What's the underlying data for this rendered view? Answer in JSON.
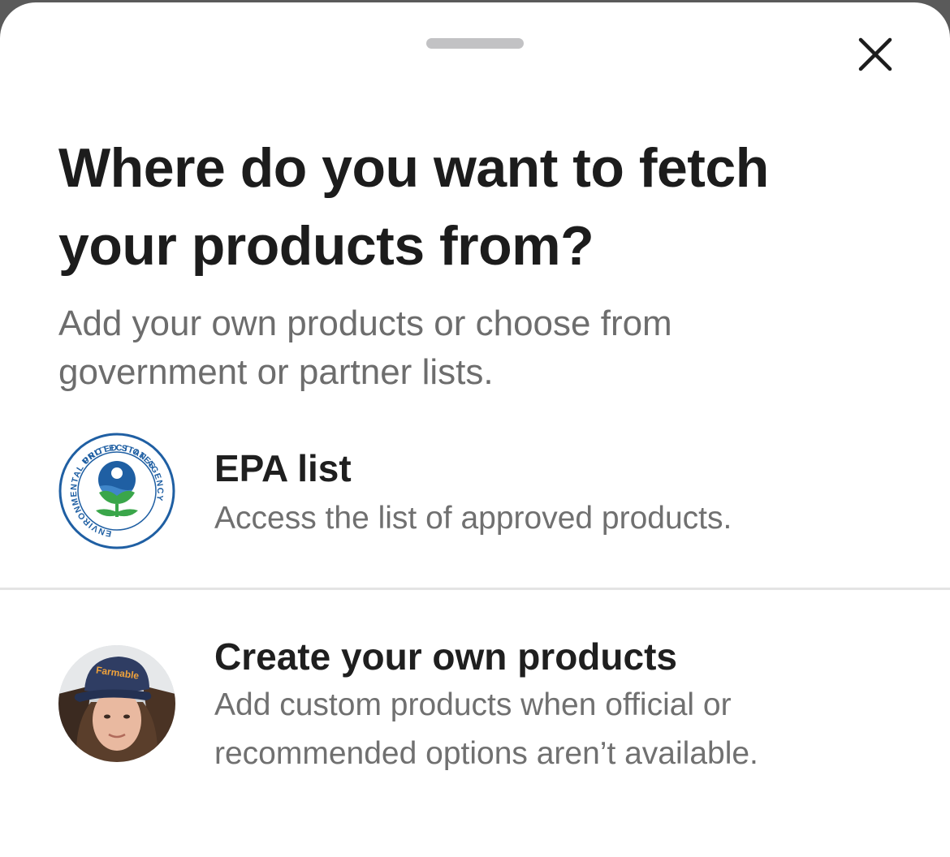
{
  "sheet": {
    "title": "Where do you want to fetch your products from?",
    "subtitle": "Add your own products or choose from government or partner lists.",
    "close_icon": "close-icon"
  },
  "options": [
    {
      "icon": "epa-seal-logo",
      "logo_text_top": "UNITED STATES",
      "logo_text_ring": "ENVIRONMENTAL PROTECTION AGENCY",
      "title": "EPA list",
      "description": "Access the list of approved products."
    },
    {
      "icon": "user-avatar-photo",
      "cap_text": "Farmable",
      "title": "Create your own products",
      "description": "Add custom products when official or recommended options aren’t available."
    }
  ],
  "colors": {
    "title": "#1c1c1c",
    "secondary_text": "#6d6d6d",
    "epa_blue": "#1f5fa3",
    "epa_green": "#3aa64a",
    "divider": "#e4e4e4"
  }
}
